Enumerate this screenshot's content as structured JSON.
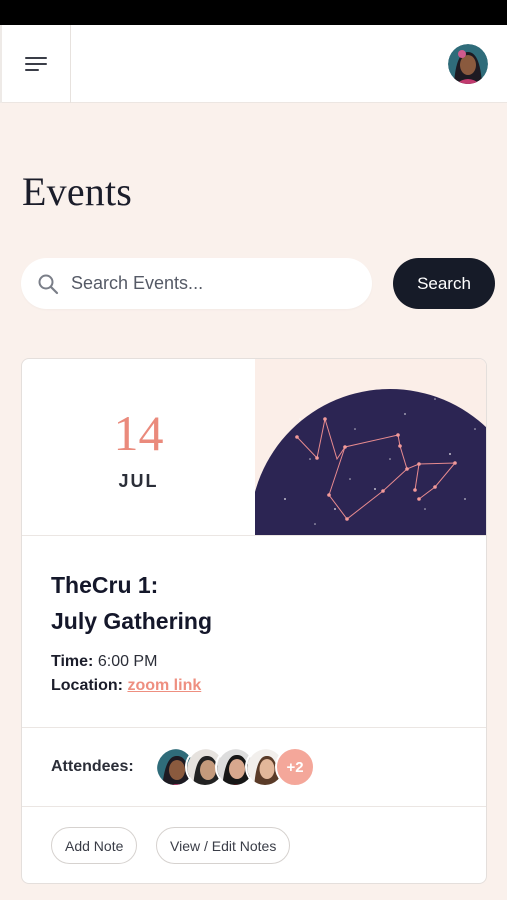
{
  "header": {
    "menu_icon": "hamburger-menu-icon",
    "avatar_icon": "user-avatar"
  },
  "page": {
    "title": "Events"
  },
  "search": {
    "placeholder": "Search Events...",
    "value": "",
    "button_label": "Search"
  },
  "event": {
    "day": "14",
    "month": "JUL",
    "title_line1": "TheCru 1:",
    "title_line2": "July Gathering",
    "time_label": "Time:",
    "time_value": "6:00 PM",
    "location_label": "Location:",
    "location_link": "zoom link",
    "attendees_label": "Attendees:",
    "attendees_more": "+2",
    "add_note_label": "Add Note",
    "view_notes_label": "View / Edit Notes"
  },
  "colors": {
    "background": "#faf1ec",
    "accent": "#ea8a7c",
    "dark_button": "#161b28",
    "night_sky": "#2c2553"
  }
}
